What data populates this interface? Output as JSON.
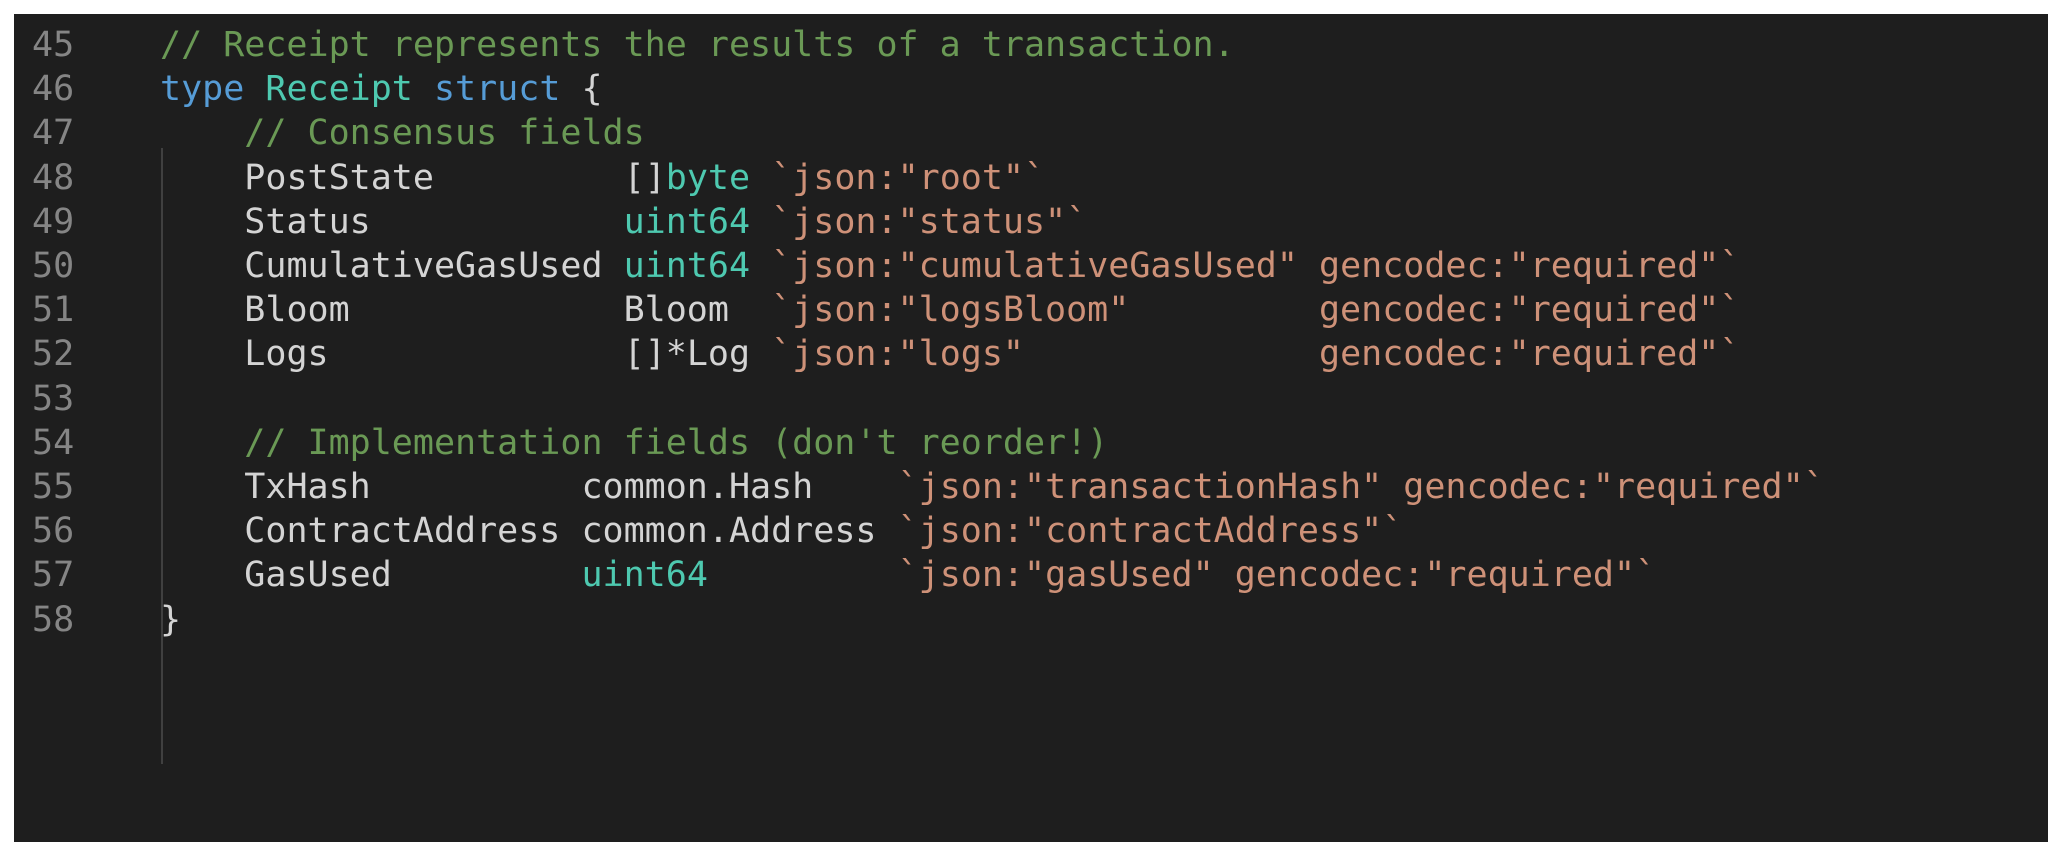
{
  "editor": {
    "lines": [
      {
        "num": "45",
        "code": "// Receipt represents the results of a transaction."
      },
      {
        "num": "46",
        "code": "type Receipt struct {"
      },
      {
        "num": "47",
        "code": "    // Consensus fields"
      },
      {
        "num": "48",
        "code": "    PostState         []byte `json:\"root\"`"
      },
      {
        "num": "49",
        "code": "    Status            uint64 `json:\"status\"`"
      },
      {
        "num": "50",
        "code": "    CumulativeGasUsed uint64 `json:\"cumulativeGasUsed\" gencodec:\"required\"`"
      },
      {
        "num": "51",
        "code": "    Bloom             Bloom  `json:\"logsBloom\"         gencodec:\"required\"`"
      },
      {
        "num": "52",
        "code": "    Logs              []*Log `json:\"logs\"              gencodec:\"required\"`"
      },
      {
        "num": "53",
        "code": ""
      },
      {
        "num": "54",
        "code": "    // Implementation fields (don't reorder!)"
      },
      {
        "num": "55",
        "code": "    TxHash          common.Hash    `json:\"transactionHash\" gencodec:\"required\"`"
      },
      {
        "num": "56",
        "code": "    ContractAddress common.Address `json:\"contractAddress\"`"
      },
      {
        "num": "57",
        "code": "    GasUsed         uint64         `json:\"gasUsed\" gencodec:\"required\"`"
      },
      {
        "num": "58",
        "code": "}"
      }
    ]
  },
  "colors": {
    "background": "#1e1e1e",
    "line_number": "#858585",
    "comment": "#6a9955",
    "keyword": "#569cd6",
    "type": "#4ec9b0",
    "string": "#ce9178",
    "text": "#d4d4d4"
  }
}
